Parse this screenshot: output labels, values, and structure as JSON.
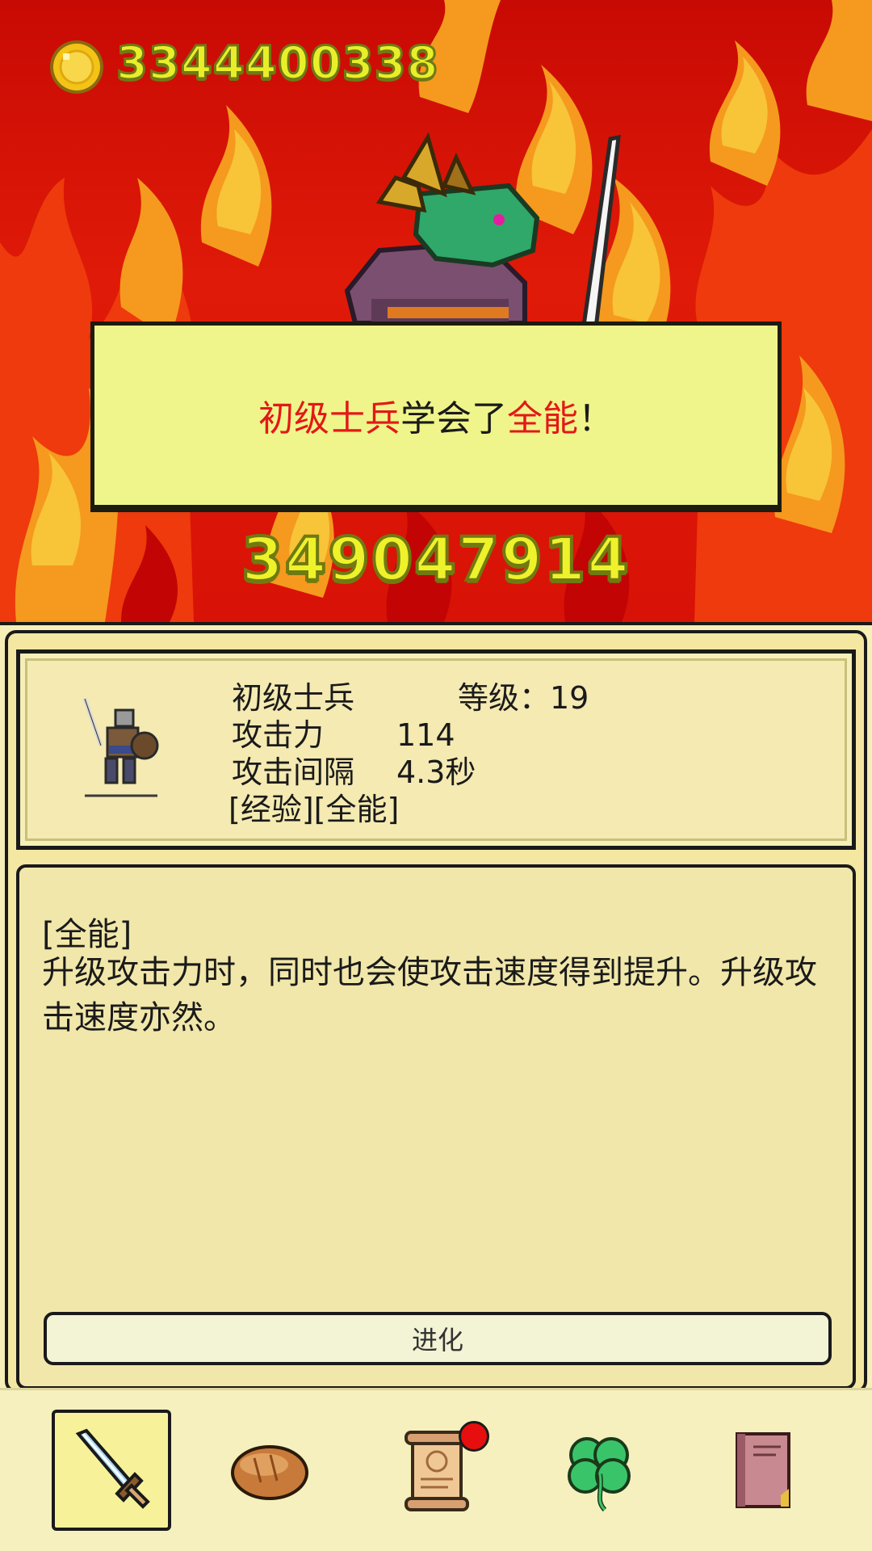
{
  "hud": {
    "gold_amount": "3344400338",
    "gold_icon": "gold-coin-icon"
  },
  "boss": {
    "hp": "349047914",
    "sprite": "dragon-warrior-boss"
  },
  "popup": {
    "unit_name": "初级士兵",
    "verb": "学会了",
    "skill_name": "全能",
    "suffix": "！"
  },
  "unit": {
    "name": "初级士兵",
    "level_label": "等级：19",
    "attack_label": "攻击力",
    "attack_value": "114",
    "interval_label": "攻击间隔",
    "interval_value": "4.3秒",
    "traits": "[经验][全能]",
    "portrait": "soldier-icon"
  },
  "skill": {
    "title": "[全能]",
    "description": "升级攻击力时，同时也会使攻击速度得到提升。升级攻击速度亦然。"
  },
  "evolve": {
    "label": "进化"
  },
  "nav": {
    "items": [
      {
        "icon": "sword-icon",
        "active": true
      },
      {
        "icon": "bread-icon",
        "active": false
      },
      {
        "icon": "scroll-icon",
        "active": false,
        "badge": true
      },
      {
        "icon": "clover-icon",
        "active": false
      },
      {
        "icon": "book-icon",
        "active": false
      }
    ]
  },
  "colors": {
    "sky_red": "#d81206",
    "flame_orange": "#f59a1e",
    "flame_yellow": "#f8c438",
    "number_yellow": "#e8ef2a",
    "popup_bg": "#eff58a",
    "highlight_red": "#e31818",
    "panel_bg": "#f6efb7",
    "badge_red": "#e60e0e"
  }
}
